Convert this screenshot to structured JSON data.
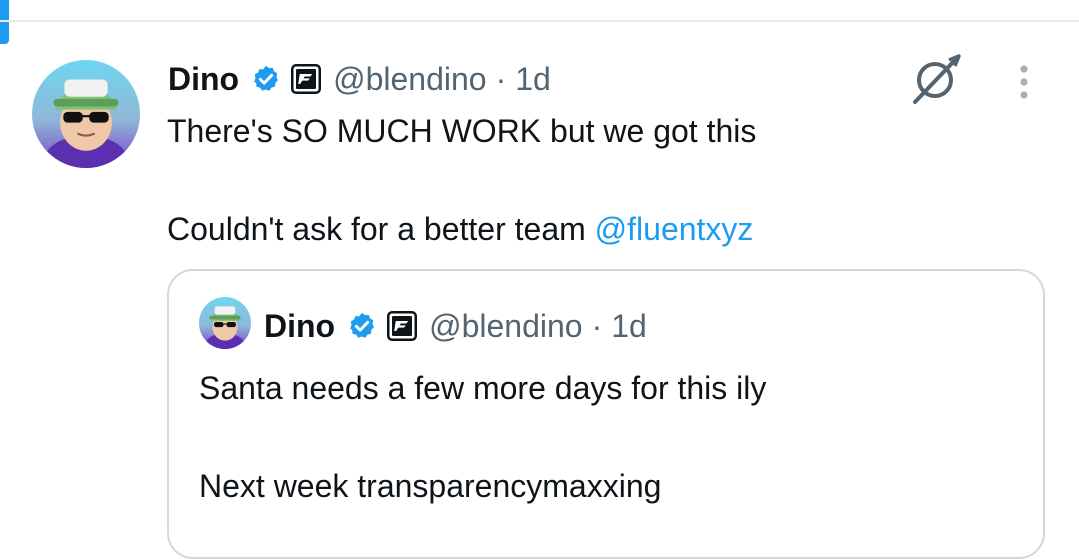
{
  "colors": {
    "accent": "#1d9bf0",
    "text_primary": "#0f1419",
    "text_secondary": "#536471",
    "border": "#cfd9de"
  },
  "post": {
    "author_name": "Dino",
    "handle": "@blendino",
    "separator": "·",
    "time": "1d",
    "text_line1": "There's SO MUCH WORK but we got this",
    "text_line2_prefix": "Couldn't ask for a better team ",
    "mention": "@fluentxyz",
    "icons": {
      "verified": "verified-badge-icon",
      "affiliation": "affiliation-logo-icon",
      "grok": "grok-icon",
      "more": "more-options-icon"
    }
  },
  "quoted_post": {
    "author_name": "Dino",
    "handle": "@blendino",
    "separator": "·",
    "time": "1d",
    "text_line1": "Santa needs a few more days for this ily",
    "text_line2": "Next week transparencymaxxing"
  }
}
